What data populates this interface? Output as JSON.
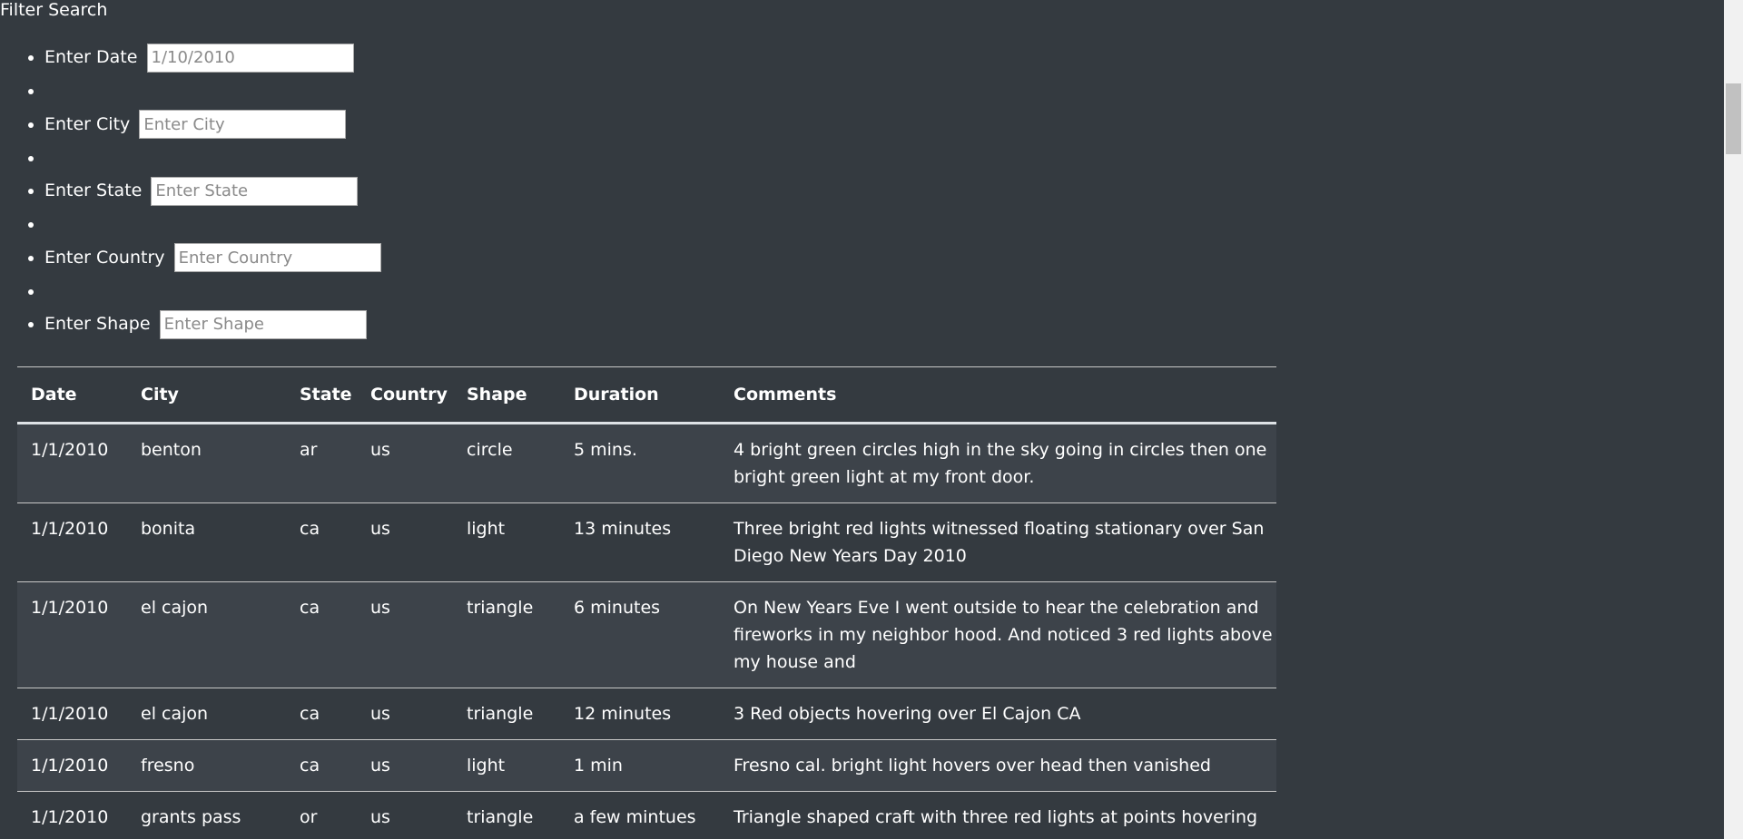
{
  "filter": {
    "title": "Filter Search",
    "fields": [
      {
        "label": "Enter Date",
        "value": "",
        "placeholder": "1/10/2010"
      },
      {
        "label": "Enter City",
        "value": "",
        "placeholder": "Enter City"
      },
      {
        "label": "Enter State",
        "value": "",
        "placeholder": "Enter State"
      },
      {
        "label": "Enter Country",
        "value": "",
        "placeholder": "Enter Country"
      },
      {
        "label": "Enter Shape",
        "value": "",
        "placeholder": "Enter Shape"
      }
    ]
  },
  "table": {
    "headers": [
      "Date",
      "City",
      "State",
      "Country",
      "Shape",
      "Duration",
      "Comments"
    ],
    "rows": [
      [
        "1/1/2010",
        "benton",
        "ar",
        "us",
        "circle",
        "5 mins.",
        "4 bright green circles high in the sky going in circles then one bright green light at my front door."
      ],
      [
        "1/1/2010",
        "bonita",
        "ca",
        "us",
        "light",
        "13 minutes",
        "Three bright red lights witnessed floating stationary over San Diego New Years Day 2010"
      ],
      [
        "1/1/2010",
        "el cajon",
        "ca",
        "us",
        "triangle",
        "6 minutes",
        "On New Years Eve I went outside to hear the celebration and fireworks in my neighbor hood. And noticed 3 red lights above my house and"
      ],
      [
        "1/1/2010",
        "el cajon",
        "ca",
        "us",
        "triangle",
        "12 minutes",
        "3 Red objects hovering over El Cajon CA"
      ],
      [
        "1/1/2010",
        "fresno",
        "ca",
        "us",
        "light",
        "1 min",
        "Fresno cal. bright light hovers over head then vanished"
      ],
      [
        "1/1/2010",
        "grants pass",
        "or",
        "us",
        "triangle",
        "a few mintues",
        "Triangle shaped craft with three red lights at points hovering over"
      ]
    ]
  }
}
